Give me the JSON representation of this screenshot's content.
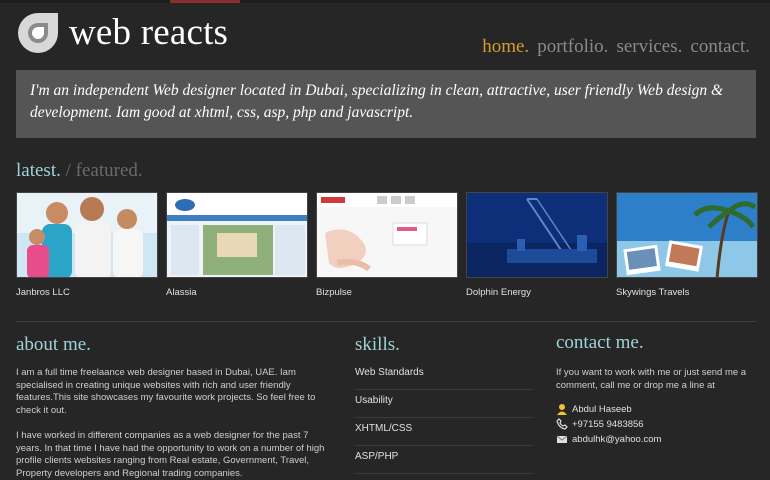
{
  "header": {
    "logo_text": "web reacts",
    "nav": [
      {
        "label": "home."
      },
      {
        "label": "portfolio."
      },
      {
        "label": "services."
      },
      {
        "label": "contact."
      }
    ]
  },
  "intro": {
    "text": "I'm an independent Web designer located in Dubai, specializing in clean, attractive, user friendly Web design & development. Iam good at xhtml, css, asp, php and javascript."
  },
  "latest": {
    "tab_latest": "latest.",
    "tab_featured": "/ featured.",
    "items": [
      {
        "caption": "Janbros LLC"
      },
      {
        "caption": "Alassia"
      },
      {
        "caption": "Bizpulse"
      },
      {
        "caption": "Dolphin Energy"
      },
      {
        "caption": "Skywings Travels"
      }
    ]
  },
  "about": {
    "title": "about me.",
    "para1": "I am a full time freelaance web designer based in Dubai, UAE. Iam specialised in creating unique websites with rich and user friendly features.This site showcases my favourite work projects. So feel free to check it out.",
    "para2": "I have worked in different companies as a web designer for the past 7 years. In that time I have had the opportunity to work on a number of high profile clients websites ranging from Real estate, Government, Travel, Property developers and Regional trading companies."
  },
  "skills": {
    "title": "skills.",
    "items": [
      "Web Standards",
      "Usability",
      "XHTML/CSS",
      "ASP/PHP"
    ]
  },
  "contact": {
    "title": "contact me.",
    "text": "If you want to work with me or just send me a comment, call me or drop me a line at",
    "name": "Abdul Haseeb",
    "phone": "+97155 9483856",
    "email": "abdulhk@yahoo.com"
  },
  "colors": {
    "background": "#262626",
    "accent_orange": "#d59b2f",
    "accent_teal": "#9ed4d8",
    "intro_bg": "#555555"
  },
  "icons": [
    "logo-mark-icon",
    "user-icon",
    "phone-icon",
    "email-icon"
  ]
}
